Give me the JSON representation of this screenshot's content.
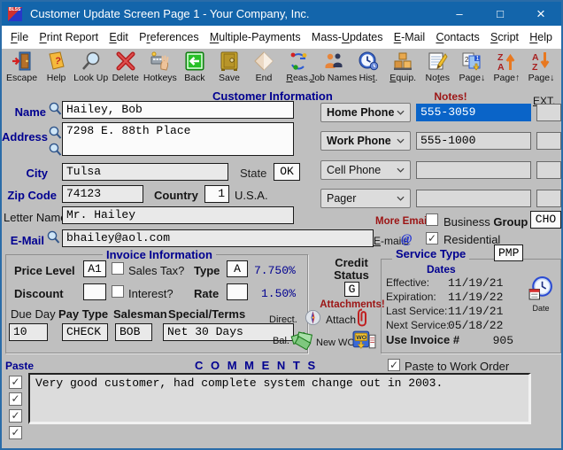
{
  "colors": {
    "titlebar": "#1365ab",
    "label_navy": "#000090",
    "alert_red": "#9c1414",
    "selection_blue": "#0a64c8",
    "window_bg": "#bfbfbf"
  },
  "window": {
    "title": "Customer Update Screen Page 1 - Your Company, Inc.",
    "icon_text": "BLSS",
    "minimize": "–",
    "maximize": "□",
    "close": "×"
  },
  "menubar": {
    "items": [
      {
        "pre": "",
        "key": "F",
        "post": "ile"
      },
      {
        "pre": "",
        "key": "P",
        "post": "rint Report"
      },
      {
        "pre": "",
        "key": "E",
        "post": "dit"
      },
      {
        "pre": "P",
        "key": "r",
        "post": "eferences"
      },
      {
        "pre": "",
        "key": "M",
        "post": "ultiple-Payments"
      },
      {
        "pre": "Mass-",
        "key": "U",
        "post": "pdates"
      },
      {
        "pre": "",
        "key": "E",
        "post": "-Mail"
      },
      {
        "pre": "",
        "key": "C",
        "post": "ontacts"
      },
      {
        "pre": "",
        "key": "S",
        "post": "cript"
      },
      {
        "pre": "",
        "key": "H",
        "post": "elp"
      }
    ]
  },
  "toolbar": {
    "buttons": [
      {
        "name": "escape",
        "icon": "door",
        "pre": "Escape",
        "key": "",
        "post": ""
      },
      {
        "name": "help",
        "icon": "help-book",
        "pre": "Help",
        "key": "",
        "post": ""
      },
      {
        "name": "look-up",
        "icon": "magnifier",
        "pre": "Look Up",
        "key": "",
        "post": ""
      },
      {
        "name": "delete",
        "icon": "delete-x",
        "pre": "Delete",
        "key": "",
        "post": ""
      },
      {
        "name": "hotkeys",
        "icon": "hotkeys-hand",
        "pre": "Hotkeys",
        "key": "",
        "post": ""
      },
      {
        "name": "back",
        "icon": "back-arrow",
        "pre": "Back",
        "key": "",
        "post": ""
      },
      {
        "name": "save",
        "icon": "safe",
        "pre": "Save",
        "key": "",
        "post": ""
      },
      {
        "name": "end",
        "icon": "end-diamond",
        "pre": "End",
        "key": "",
        "post": ""
      },
      {
        "name": "reas",
        "icon": "reassign-arrows",
        "pre": "",
        "key": "R",
        "post": "eas."
      },
      {
        "name": "job-names",
        "icon": "job-people",
        "pre": "",
        "key": "J",
        "post": "ob Names"
      },
      {
        "name": "hist",
        "icon": "history-clock",
        "pre": "His",
        "key": "t",
        "post": "."
      },
      {
        "name": "equip",
        "icon": "equip-boxes",
        "pre": "",
        "key": "E",
        "post": "quip."
      },
      {
        "name": "notes",
        "icon": "notes-pad",
        "pre": "No",
        "key": "t",
        "post": "es"
      },
      {
        "name": "page-down-goto",
        "icon": "pages-12",
        "pre": "Page↓",
        "key": "",
        "post": ""
      },
      {
        "name": "page-up",
        "icon": "sort-za-up",
        "pre": "Page↑",
        "key": "",
        "post": ""
      },
      {
        "name": "page-down",
        "icon": "sort-az-down",
        "pre": "Page↓",
        "key": "",
        "post": ""
      }
    ]
  },
  "customer": {
    "header": "Customer Information",
    "name_label": "Name",
    "name": "Hailey, Bob",
    "address_label": "Address",
    "address": "7298 E. 88th Place",
    "city_label": "City",
    "city": "Tulsa",
    "state_label": "State",
    "state": "OK",
    "zip_label": "Zip Code",
    "zip": "74123",
    "country_label": "Country",
    "country": "1",
    "country_name": "U.S.A.",
    "letter_label": "Letter Name",
    "letter_name": "Mr. Hailey",
    "email_label": "E-Mail",
    "email": "bhailey@aol.com",
    "emails_key": "E",
    "emails_post": "-mails",
    "more_emails_label": "More Emails",
    "business_label": "Business ",
    "group_label": "Group",
    "group_value": "CHO",
    "business_checked": false,
    "residential_label": "Residential",
    "residential_checked": true,
    "notes_label": "Notes!",
    "ext_label": "EXT."
  },
  "phones": {
    "rows": [
      {
        "label": "Home Phone",
        "bold": true,
        "value": "555-3059",
        "selected": true,
        "ext": ""
      },
      {
        "label": "Work Phone",
        "bold": true,
        "value": "555-1000",
        "selected": false,
        "ext": ""
      },
      {
        "label": "Cell Phone",
        "bold": false,
        "value": "",
        "selected": false,
        "ext": ""
      },
      {
        "label": "Pager",
        "bold": false,
        "value": "",
        "selected": false,
        "ext": ""
      }
    ]
  },
  "invoice": {
    "title": "Invoice Information",
    "price_level_label": "Price Level",
    "price_level": "A1",
    "sales_tax_label": "Sales Tax?",
    "sales_tax_checked": false,
    "type_label": "Type",
    "type_value": "A",
    "tax_rate": "7.750%",
    "discount_label": "Discount",
    "discount": "",
    "interest_label": "Interest?",
    "interest_checked": false,
    "rate_label": "Rate",
    "rate": "",
    "interest_rate": "1.50%",
    "due_day_label": "Due Day",
    "due_day": "10",
    "pay_type_label": "Pay Type",
    "pay_type": "CHECK",
    "salesman_label": "Salesman",
    "salesman": "BOB",
    "terms_label": "Special/Terms",
    "terms": "Net 30 Days",
    "direct_label": "Direct.",
    "bal_label": "Bal."
  },
  "credit": {
    "label_line1": "Credit",
    "label_line2": "Status",
    "value": "G",
    "attachments_label": "Attachments!",
    "attach_label": "Attach",
    "new_wo_label": "New WO"
  },
  "service": {
    "title": "Service Type",
    "type_value": "PMP",
    "dates_label": "Dates",
    "rows": [
      {
        "label": "Effective:",
        "value": "11/19/21"
      },
      {
        "label": "Expiration:",
        "value": "11/19/22"
      },
      {
        "label": "Last Service:",
        "value": "11/19/21"
      },
      {
        "label": "Next Service:",
        "value": "05/18/22"
      }
    ],
    "use_invoice_label": "Use Invoice #",
    "invoice_number": "905",
    "date_icon_label": "Date"
  },
  "comments": {
    "paste_label": "Paste",
    "title": "C O M M E N T S",
    "paste_wo_label": "Paste to Work Order",
    "paste_wo_checked": true,
    "text": "Very good customer, had complete system change out in 2003.",
    "row_checks": [
      true,
      true,
      true,
      true
    ]
  }
}
